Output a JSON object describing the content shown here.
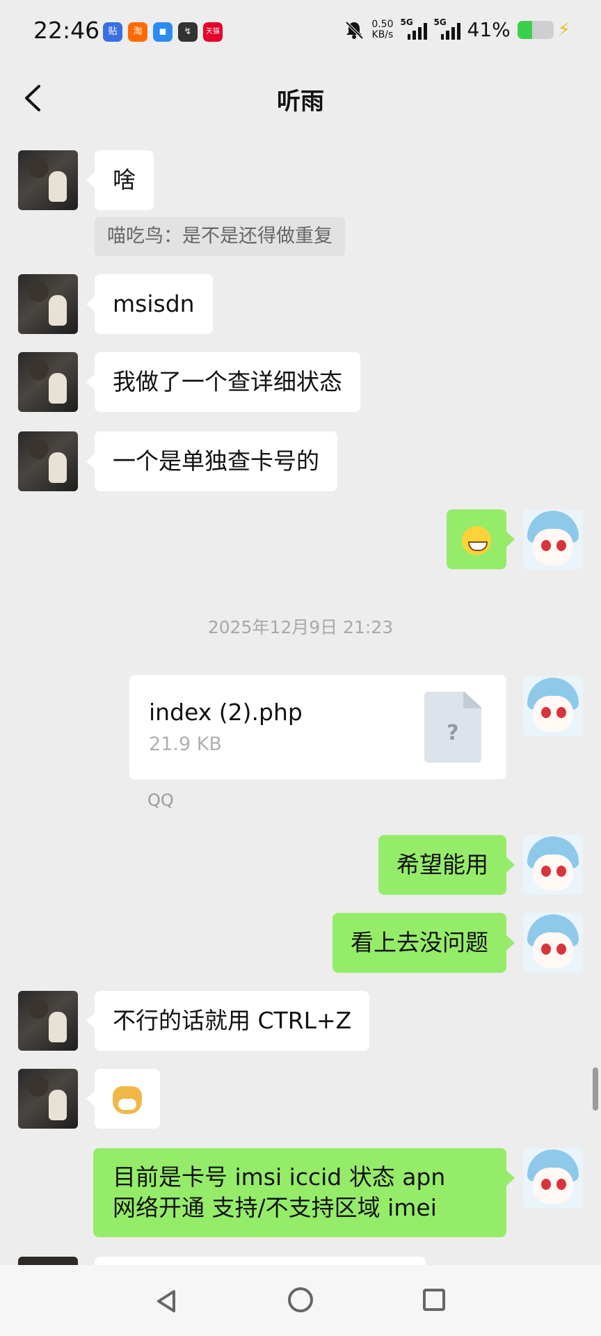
{
  "status_bar": {
    "time": "22:46",
    "app_icons": [
      {
        "name": "tieba-icon",
        "glyph": "贴",
        "color": "#3b6fe0"
      },
      {
        "name": "taobao-icon",
        "glyph": "淘",
        "color": "#ff6a00"
      },
      {
        "name": "message-app-icon",
        "glyph": "◼",
        "color": "#2a8cf0"
      },
      {
        "name": "sync-app-icon",
        "glyph": "↯",
        "color": "#333333"
      },
      {
        "name": "tmall-icon",
        "glyph": "天猫",
        "color": "#e4002b"
      }
    ],
    "net_speed_value": "0.50",
    "net_speed_unit": "KB/s",
    "signal1_label": "5G",
    "signal2_label": "5G",
    "battery": "41%",
    "battery_level": 0.41,
    "battery_color": "#3ccf4e"
  },
  "header": {
    "back_icon": "chevron-left-icon",
    "title": "听雨"
  },
  "messages": {
    "m1": "啥",
    "quote": "喵吃鸟：是不是还得做重复",
    "m2": "msisdn",
    "m3": "我做了一个查详细状态",
    "m4": "一个是单独查卡号的",
    "m5_emoji": "grin-emoji",
    "timestamp": "2025年12月9日 21:23",
    "file": {
      "name": "index (2).php",
      "size": "21.9 KB",
      "icon_glyph": "?",
      "source": "QQ"
    },
    "m6": "希望能用",
    "m7": "看上去没问题",
    "m8": "不行的话就用 CTRL+Z",
    "m9_emoji": "doge-emoji",
    "m10_line1": "目前是卡号 imsi iccid 状态 apn",
    "m10_line2": "网络开通 支持/不支持区域 imei"
  },
  "colors": {
    "background": "#ededed",
    "sent_bubble": "#95ec69",
    "received_bubble": "#ffffff"
  },
  "nav": {
    "back": "nav-back-icon",
    "home": "nav-home-icon",
    "recent": "nav-recent-icon"
  }
}
